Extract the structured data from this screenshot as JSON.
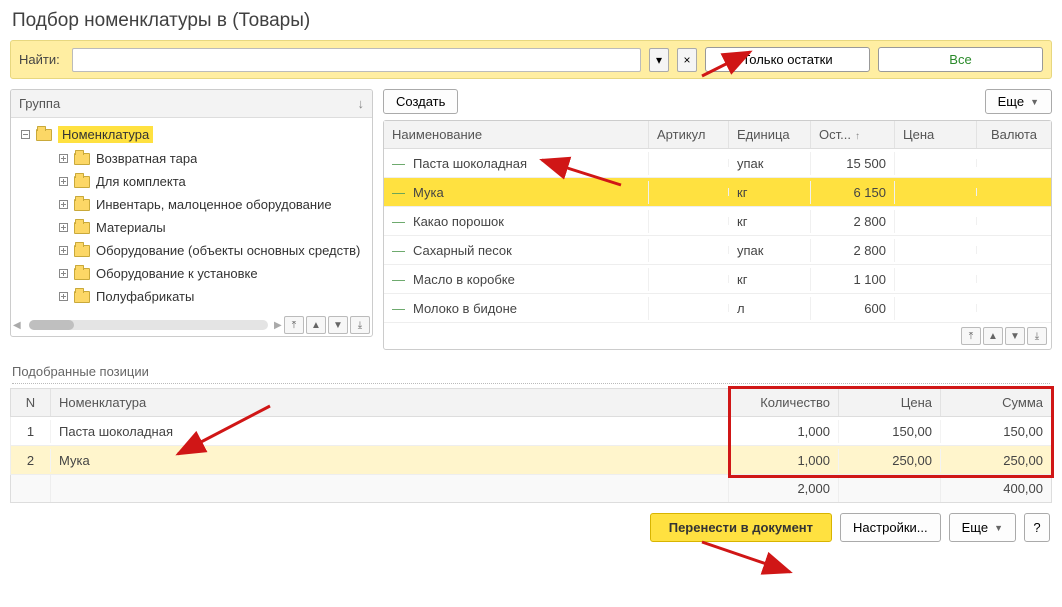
{
  "window_title": "Подбор номенклатуры в  (Товары)",
  "search": {
    "label": "Найти:",
    "value": ""
  },
  "mode_buttons": {
    "stocks_only": "Только остатки",
    "all": "Все"
  },
  "tree": {
    "header": "Группа",
    "root": "Номенклатура",
    "children": [
      "Возвратная тара",
      "Для комплекта",
      "Инвентарь, малоценное оборудование",
      "Материалы",
      "Оборудование (объекты основных средств)",
      "Оборудование к установке",
      "Полуфабрикаты"
    ]
  },
  "list": {
    "create": "Создать",
    "more": "Еще",
    "headers": {
      "name": "Наименование",
      "art": "Артикул",
      "unit": "Единица",
      "stock": "Ост...",
      "price": "Цена",
      "cur": "Валюта"
    },
    "selected_index": 1,
    "rows": [
      {
        "name": "Паста шоколадная",
        "art": "",
        "unit": "упак",
        "stock": "15 500",
        "price": "",
        "cur": ""
      },
      {
        "name": "Мука",
        "art": "",
        "unit": "кг",
        "stock": "6 150",
        "price": "",
        "cur": ""
      },
      {
        "name": "Какао порошок",
        "art": "",
        "unit": "кг",
        "stock": "2 800",
        "price": "",
        "cur": ""
      },
      {
        "name": "Сахарный песок",
        "art": "",
        "unit": "упак",
        "stock": "2 800",
        "price": "",
        "cur": ""
      },
      {
        "name": "Масло в коробке",
        "art": "",
        "unit": "кг",
        "stock": "1 100",
        "price": "",
        "cur": ""
      },
      {
        "name": "Молоко в бидоне",
        "art": "",
        "unit": "л",
        "stock": "600",
        "price": "",
        "cur": ""
      }
    ]
  },
  "picked": {
    "section": "Подобранные позиции",
    "headers": {
      "n": "N",
      "nom": "Номенклатура",
      "qty": "Количество",
      "price": "Цена",
      "sum": "Сумма"
    },
    "rows": [
      {
        "n": "1",
        "nom": "Паста шоколадная",
        "qty": "1,000",
        "price": "150,00",
        "sum": "150,00"
      },
      {
        "n": "2",
        "nom": "Мука",
        "qty": "1,000",
        "price": "250,00",
        "sum": "250,00"
      }
    ],
    "totals": {
      "qty": "2,000",
      "sum": "400,00"
    }
  },
  "footer": {
    "transfer": "Перенести в документ",
    "settings": "Настройки...",
    "more": "Еще",
    "help": "?"
  }
}
